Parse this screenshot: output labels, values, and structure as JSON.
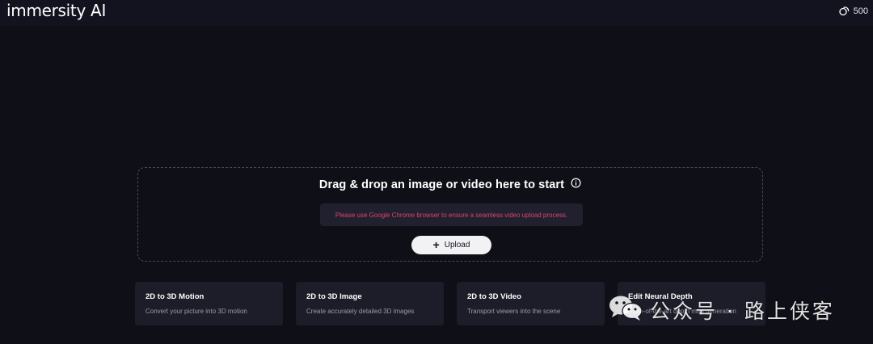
{
  "header": {
    "logo_text": "immersity AI",
    "credits_value": "500",
    "credits_icon": "coin-stack-icon"
  },
  "dropzone": {
    "title": "Drag & drop an image or video here to start",
    "info_icon": "info-circle-icon",
    "warning_text": "Please use Google Chrome browser to ensure a seamless video upload process.",
    "upload_label": "Upload",
    "upload_icon": "plus-icon"
  },
  "cards": [
    {
      "title": "2D to 3D Motion",
      "description": "Convert your picture into 3D motion"
    },
    {
      "title": "2D to 3D Image",
      "description": "Create accurately detailed 3D images"
    },
    {
      "title": "2D to 3D Video",
      "description": "Transport viewers into the scene"
    },
    {
      "title": "Edit Neural Depth",
      "description": "State-of-the-art depth map generation"
    }
  ],
  "watermark": {
    "text": "公众号 · 路上侠客",
    "icon": "wechat-icon"
  },
  "colors": {
    "background": "#0f0f17",
    "topbar": "#131320",
    "card": "#1d1d29",
    "warning_text": "#e0436d",
    "button": "#f2f2f4"
  }
}
